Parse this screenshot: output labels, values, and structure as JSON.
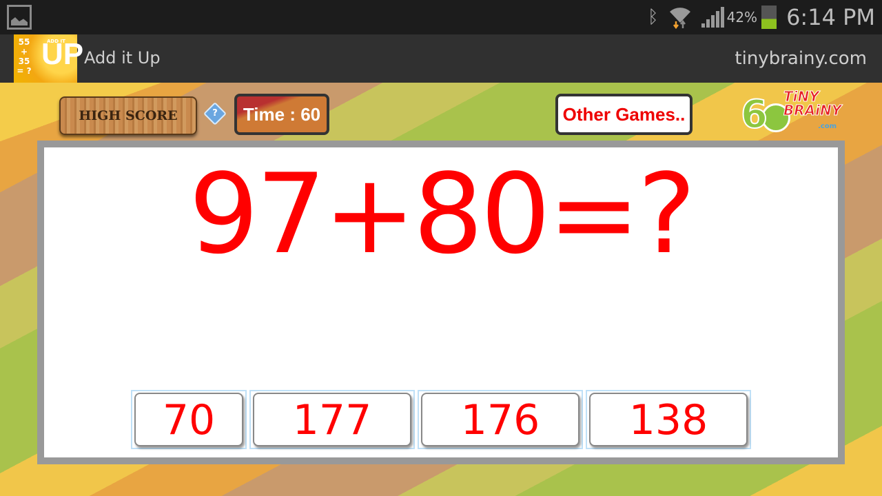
{
  "status_bar": {
    "battery_percent": "42%",
    "battery_level": 0.42,
    "time": "6:14 PM",
    "icons": [
      "gallery-icon",
      "bluetooth-icon",
      "wifi-icon",
      "signal-icon",
      "battery-icon"
    ]
  },
  "action_bar": {
    "app_title": "Add it Up",
    "site": "tinybrainy.com",
    "app_icon": {
      "nums": [
        "55",
        "+",
        "35",
        "= ?"
      ],
      "up": "UP",
      "addit": "ADD IT"
    }
  },
  "game": {
    "high_score_label": "HIGH SCORE",
    "help_label": "?",
    "timer_label": "Time : 60",
    "other_games_label": "Other Games..",
    "logo": {
      "six": "6",
      "line1": "TiNY",
      "line2": "BRAiNY",
      "com": ".com"
    },
    "equation": "97+80=?",
    "answers": [
      "70",
      "177",
      "176",
      "138"
    ]
  },
  "colors": {
    "accent_red": "#ff0000",
    "battery_green": "#8dc21f"
  }
}
